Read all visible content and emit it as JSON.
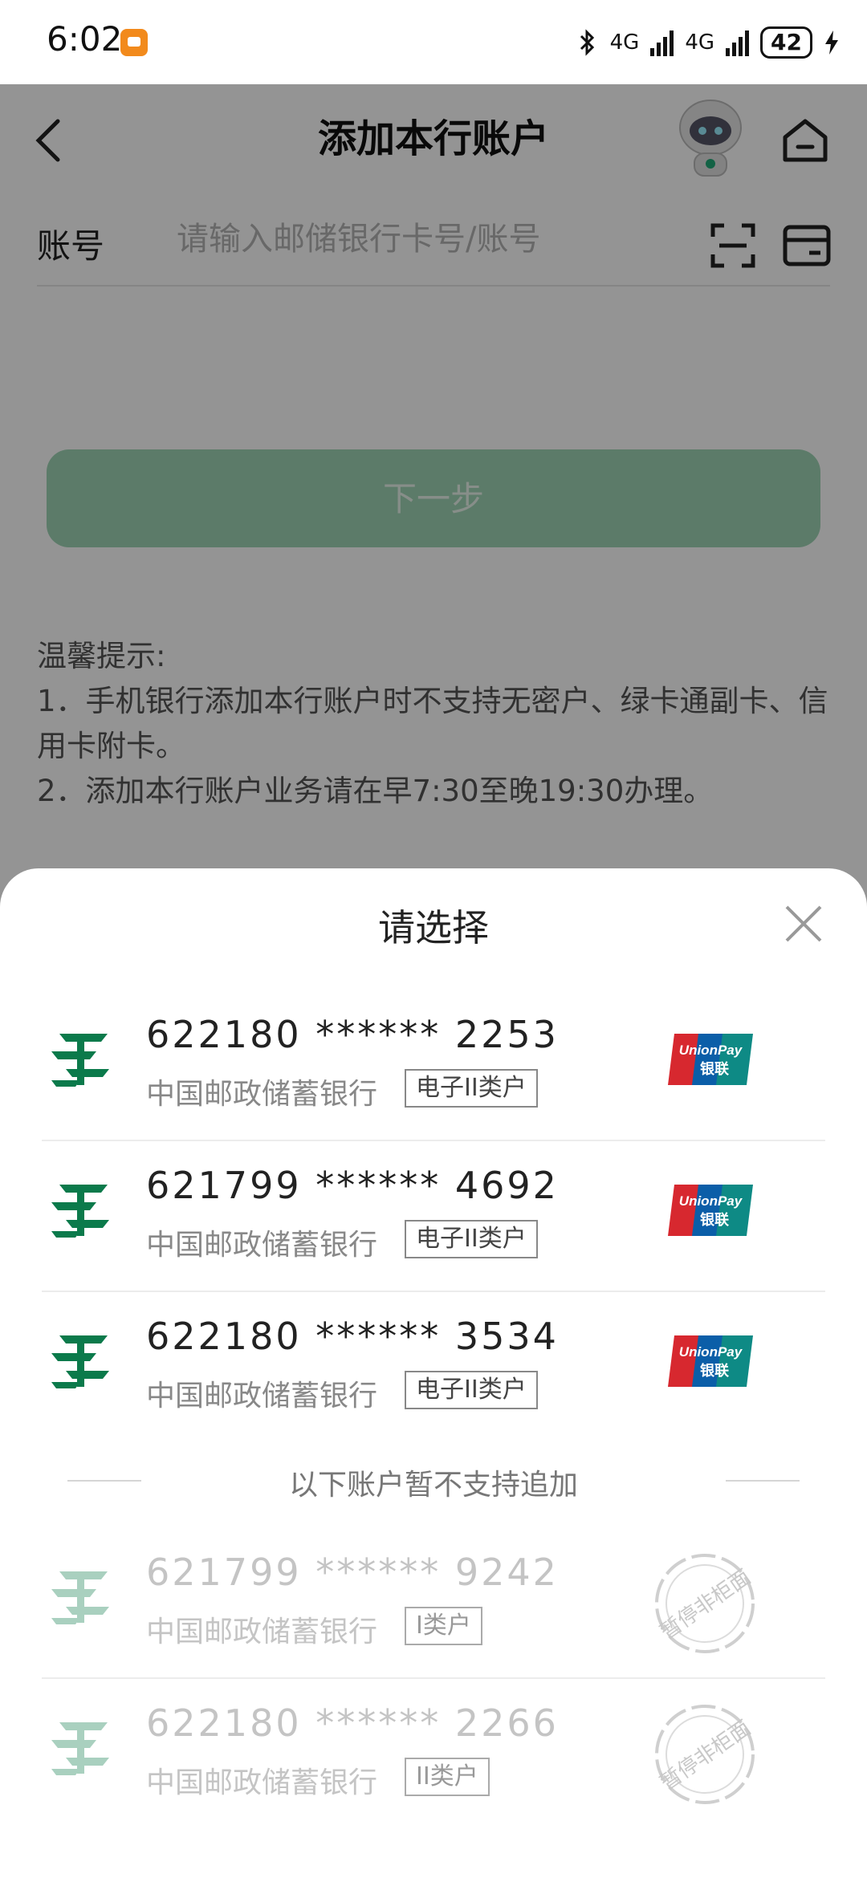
{
  "status_bar": {
    "time": "6:02",
    "network1": "4G",
    "network2": "4G",
    "battery": "42"
  },
  "header": {
    "title": "添加本行账户"
  },
  "form": {
    "account_label": "账号",
    "account_placeholder": "请输入邮储银行卡号/账号",
    "account_value": "",
    "next_button": "下一步"
  },
  "tips": {
    "heading": "温馨提示:",
    "line1": "1．手机银行添加本行账户时不支持无密户、绿卡通副卡、信用卡附卡。",
    "line2": "2．添加本行账户业务请在早7:30至晚19:30办理。"
  },
  "sheet": {
    "title": "请选择",
    "divider_text": "以下账户暂不支持追加",
    "accounts": [
      {
        "number": "622180 ****** 2253",
        "bank": "中国邮政储蓄银行",
        "type": "电子II类户",
        "network": "UnionPay银联"
      },
      {
        "number": "621799 ****** 4692",
        "bank": "中国邮政储蓄银行",
        "type": "电子II类户",
        "network": "UnionPay银联"
      },
      {
        "number": "622180 ****** 3534",
        "bank": "中国邮政储蓄银行",
        "type": "电子II类户",
        "network": "UnionPay银联"
      }
    ],
    "unsupported": [
      {
        "number": "621799 ****** 9242",
        "bank": "中国邮政储蓄银行",
        "type": "I类户",
        "stamp": "暂停非柜面"
      },
      {
        "number": "622180 ****** 2266",
        "bank": "中国邮政储蓄银行",
        "type": "II类户",
        "stamp": "暂停非柜面"
      }
    ]
  },
  "colors": {
    "brand_green": "#0b7a4b",
    "button_disabled": "#9fd4b5",
    "unionpay_red": "#d7282f",
    "unionpay_blue": "#0b5ea8",
    "unionpay_teal": "#0e8a85"
  }
}
